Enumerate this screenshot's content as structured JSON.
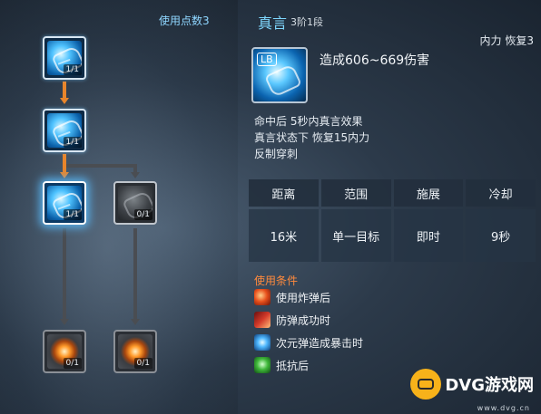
{
  "tree": {
    "points_label": "使用点数3",
    "nodes": [
      {
        "count": "1/1",
        "state": "active"
      },
      {
        "count": "1/1",
        "state": "active"
      },
      {
        "count": "1/1",
        "state": "selected"
      },
      {
        "count": "0/1",
        "state": "locked"
      },
      {
        "count": "0/1",
        "state": "locked"
      },
      {
        "count": "0/1",
        "state": "locked"
      }
    ]
  },
  "skill": {
    "name": "真言",
    "rank": "3阶1段",
    "cost": "内力 恢复3",
    "key": "LB",
    "damage": "造成606~669伤害",
    "description": [
      "命中后 5秒内真言效果",
      "真言状态下 恢复15内力",
      "反制穿刺"
    ]
  },
  "stats": {
    "headers": [
      "距离",
      "范围",
      "施展",
      "冷却"
    ],
    "values": [
      "16米",
      "单一目标",
      "即时",
      "9秒"
    ]
  },
  "conditions": {
    "title": "使用条件",
    "items": [
      {
        "label": "使用炸弹后",
        "icon": "bomb-flame-icon"
      },
      {
        "label": "防弹成功时",
        "icon": "deflect-icon"
      },
      {
        "label": "次元弹造成暴击时",
        "icon": "dimension-orb-icon"
      },
      {
        "label": "抵抗后",
        "icon": "resist-icon"
      }
    ]
  },
  "colors": {
    "accent_blue": "#7fd8ff",
    "accent_orange": "#ff8a3d",
    "connector_active": "#e8852b",
    "connector_inactive": "#4a4d52"
  },
  "watermark": {
    "brand": "DVG游戏网",
    "url": "www.dvg.cn"
  }
}
